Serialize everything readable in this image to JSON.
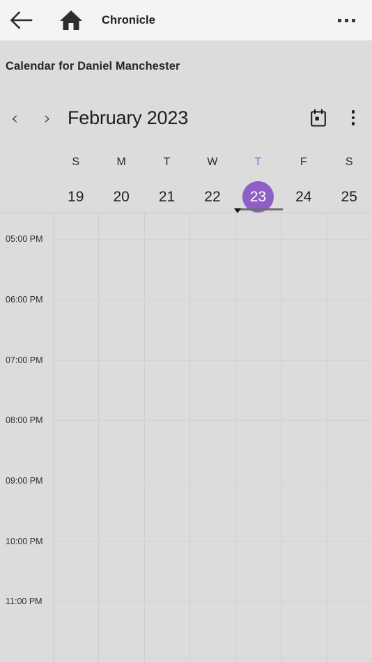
{
  "appbar": {
    "back_icon": "back-arrow-icon",
    "home_icon": "home-icon",
    "title": "Chronicle",
    "more_icon": "overflow-ellipsis-icon"
  },
  "page": {
    "title": "Calendar for Daniel Manchester"
  },
  "monthbar": {
    "prev_label": "‹",
    "next_label": "›",
    "month_label": "February 2023",
    "calendar_icon": "calendar-picker-icon",
    "overflow_icon": "vertical-dots-icon"
  },
  "week": {
    "days": [
      {
        "dow": "S",
        "date": "19",
        "selected": false
      },
      {
        "dow": "M",
        "date": "20",
        "selected": false
      },
      {
        "dow": "T",
        "date": "21",
        "selected": false
      },
      {
        "dow": "W",
        "date": "22",
        "selected": false
      },
      {
        "dow": "T",
        "date": "23",
        "selected": true
      },
      {
        "dow": "F",
        "date": "24",
        "selected": false
      },
      {
        "dow": "S",
        "date": "25",
        "selected": false
      }
    ],
    "selected_index": 4,
    "accent_color": "#8f5fc6"
  },
  "timegrid": {
    "times": [
      "05:00 PM",
      "06:00 PM",
      "07:00 PM",
      "08:00 PM",
      "09:00 PM",
      "10:00 PM",
      "11:00 PM"
    ],
    "events": []
  },
  "colors": {
    "appbar_bg": "#f4f4f4",
    "body_bg": "#dcdcdc",
    "accent": "#8f5fc6",
    "gridline": "#cfcfcf",
    "text": "#1d1d1d"
  }
}
